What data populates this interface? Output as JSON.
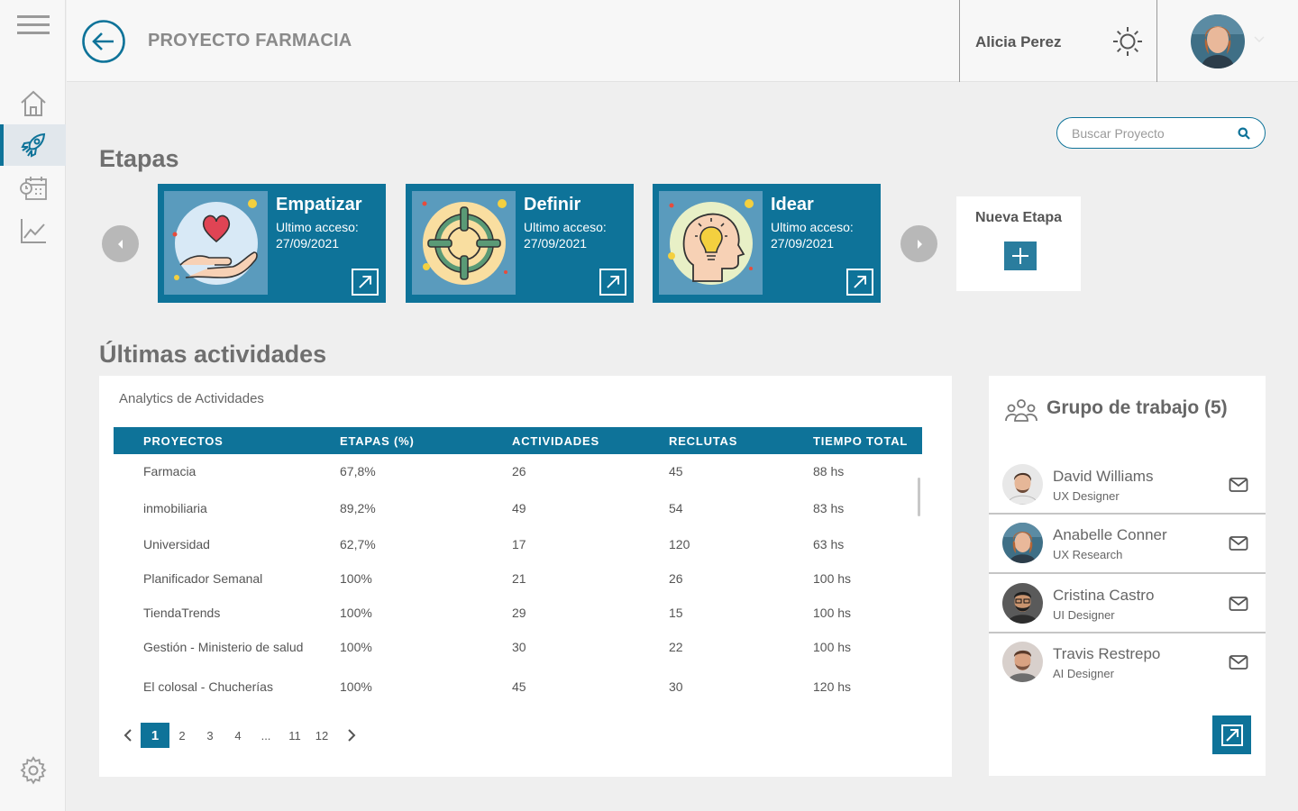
{
  "header": {
    "project_title": "PROYECTO FARMACIA",
    "user_name": "Alicia Perez"
  },
  "search": {
    "placeholder": "Buscar Proyecto"
  },
  "stages": {
    "title": "Etapas",
    "items": [
      {
        "name": "Empatizar",
        "access_label": "Ultimo acceso:",
        "date": "27/09/2021",
        "icon": "heart-hand-icon"
      },
      {
        "name": "Definir",
        "access_label": "Ultimo acceso:",
        "date": "27/09/2021",
        "icon": "target-icon"
      },
      {
        "name": "Idear",
        "access_label": "Ultimo acceso:",
        "date": "27/09/2021",
        "icon": "idea-head-icon"
      }
    ],
    "new_stage_label": "Nueva Etapa"
  },
  "activities": {
    "title": "Últimas actividades",
    "panel_title": "Analytics de Actividades",
    "columns": [
      "PROYECTOS",
      "ETAPAS (%)",
      "ACTIVIDADES",
      "RECLUTAS",
      "TIEMPO TOTAL"
    ],
    "rows": [
      [
        "Farmacia",
        "67,8%",
        "26",
        "45",
        "88 hs"
      ],
      [
        "inmobiliaria",
        "89,2%",
        "49",
        "54",
        "83 hs"
      ],
      [
        "Universidad",
        "62,7%",
        "17",
        "120",
        "63 hs"
      ],
      [
        "Planificador Semanal",
        "100%",
        "21",
        "26",
        "100 hs"
      ],
      [
        "TiendaTrends",
        "100%",
        "29",
        "15",
        "100 hs"
      ],
      [
        "Gestión - Ministerio de salud",
        "100%",
        "30",
        "22",
        "100 hs"
      ],
      [
        "El colosal - Chucherías",
        "100%",
        "45",
        "30",
        "120 hs"
      ]
    ],
    "pagination": {
      "pages": [
        "1",
        "2",
        "3",
        "4",
        "...",
        "11",
        "12"
      ],
      "current": "1"
    }
  },
  "team": {
    "title": "Grupo de trabajo (5)",
    "members": [
      {
        "name": "David Williams",
        "role": "UX Designer"
      },
      {
        "name": "Anabelle Conner",
        "role": "UX Research"
      },
      {
        "name": "Cristina Castro",
        "role": "UI Designer"
      },
      {
        "name": "Travis Restrepo",
        "role": "AI Designer"
      }
    ]
  },
  "colors": {
    "primary": "#0e7399",
    "background": "#efefef",
    "sidebar": "#f7f7f7",
    "muted_text": "#6f6f6f"
  }
}
